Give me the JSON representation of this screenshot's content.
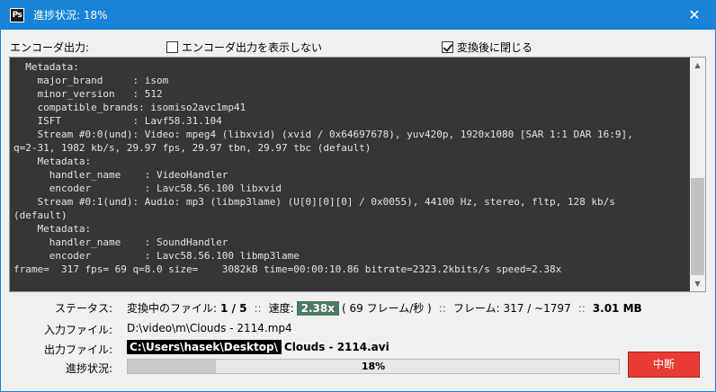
{
  "window": {
    "title": "進捗状況: 18%",
    "icon_text": "Ps",
    "close_glyph": "✕"
  },
  "encoder": {
    "label": "エンコーダ出力:",
    "show_checkbox": {
      "label": "エンコーダ出力を表示しない",
      "checked": false
    },
    "close_checkbox": {
      "label": "変換後に閉じる",
      "checked": true
    }
  },
  "console": {
    "lines": [
      "  Metadata:",
      "    major_brand     : isom",
      "    minor_version   : 512",
      "    compatible_brands: isomiso2avc1mp41",
      "    ISFT            : Lavf58.31.104",
      "    Stream #0:0(und): Video: mpeg4 (libxvid) (xvid / 0x64697678), yuv420p, 1920x1080 [SAR 1:1 DAR 16:9],",
      "q=2-31, 1982 kb/s, 29.97 fps, 29.97 tbn, 29.97 tbc (default)",
      "    Metadata:",
      "      handler_name    : VideoHandler",
      "      encoder         : Lavc58.56.100 libxvid",
      "    Stream #0:1(und): Audio: mp3 (libmp3lame) (U[0][0][0] / 0x0055), 44100 Hz, stereo, fltp, 128 kb/s",
      "(default)",
      "    Metadata:",
      "      handler_name    : SoundHandler",
      "      encoder         : Lavc58.56.100 libmp3lame",
      "frame=  317 fps= 69 q=8.0 size=    3082kB time=00:00:10.86 bitrate=2323.2kbits/s speed=2.38x"
    ]
  },
  "status": {
    "label": "ステータス:",
    "converting_label": "変換中のファイル:",
    "converting_value": "1 / 5",
    "sep": "::",
    "speed_label": "速度:",
    "speed_value": "2.38x",
    "fps_text": "( 69 フレーム/秒 )",
    "frames_label": "フレーム:",
    "frames_value": "317 / ~1797",
    "size_value": "3.01 MB"
  },
  "input": {
    "label": "入力ファイル:",
    "value": "D:\\video\\m\\Clouds - 2114.mp4"
  },
  "output": {
    "label": "出力ファイル:",
    "path": "C:\\Users\\hasek\\Desktop\\",
    "name": "Clouds - 2114.avi"
  },
  "progress": {
    "label": "進捗状況:",
    "percent_text": "18%",
    "fraction": 0.18
  },
  "buttons": {
    "abort": "中断"
  },
  "colors": {
    "titlebar": "#1883d7",
    "console_bg": "#363636",
    "speed_badge": "#4a7a63",
    "abort_button": "#e83c34"
  }
}
